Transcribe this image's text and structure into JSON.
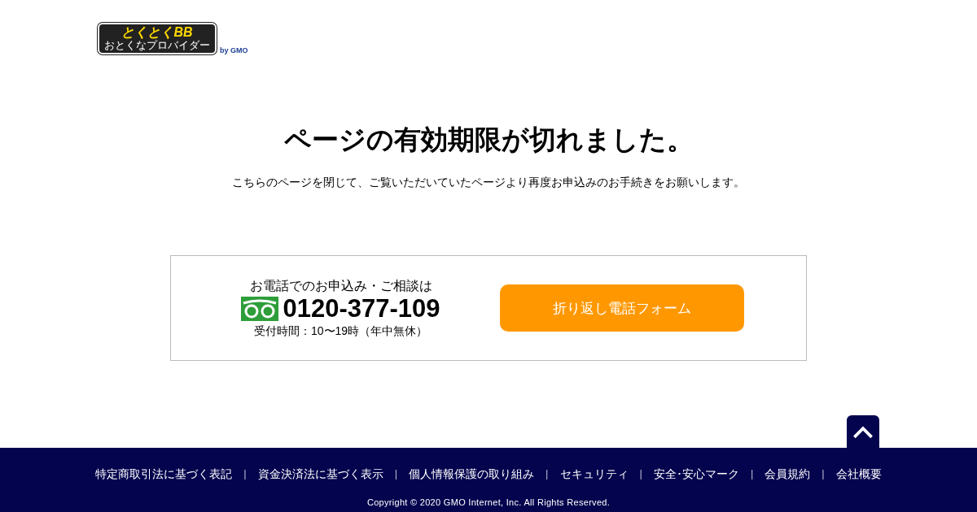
{
  "logo": {
    "title": "とくとくBB",
    "tagline": "おとくなプロバイダー",
    "by": "by GMO"
  },
  "heading": "ページの有効期限が切れました。",
  "message": "こちらのページを閉じて、ご覧いただいていたページより再度お申込みのお手続きをお願いします。",
  "contact": {
    "lead": "お電話でのお申込み・ご相談は",
    "phone": "0120-377-109",
    "hours": "受付時間：10〜19時（年中無休）",
    "button": "折り返し電話フォーム"
  },
  "footer": {
    "items": [
      {
        "kind": "link",
        "text": "特定商取引法に基づく表記"
      },
      {
        "kind": "separator",
        "text": "|"
      },
      {
        "kind": "link",
        "text": "資金決済法に基づく表示"
      },
      {
        "kind": "separator",
        "text": "|"
      },
      {
        "kind": "link",
        "text": "個人情報保護の取り組み"
      },
      {
        "kind": "separator",
        "text": "|"
      },
      {
        "kind": "link",
        "text": "セキュリティ"
      },
      {
        "kind": "separator",
        "text": "|"
      },
      {
        "kind": "link",
        "text": "安全･安心マーク"
      },
      {
        "kind": "separator",
        "text": "|"
      },
      {
        "kind": "link",
        "text": "会員規約"
      },
      {
        "kind": "separator",
        "text": "|"
      },
      {
        "kind": "link",
        "text": "会社概要"
      }
    ],
    "copyright": "Copyright © 2020 GMO Internet, Inc. All Rights Reserved."
  }
}
